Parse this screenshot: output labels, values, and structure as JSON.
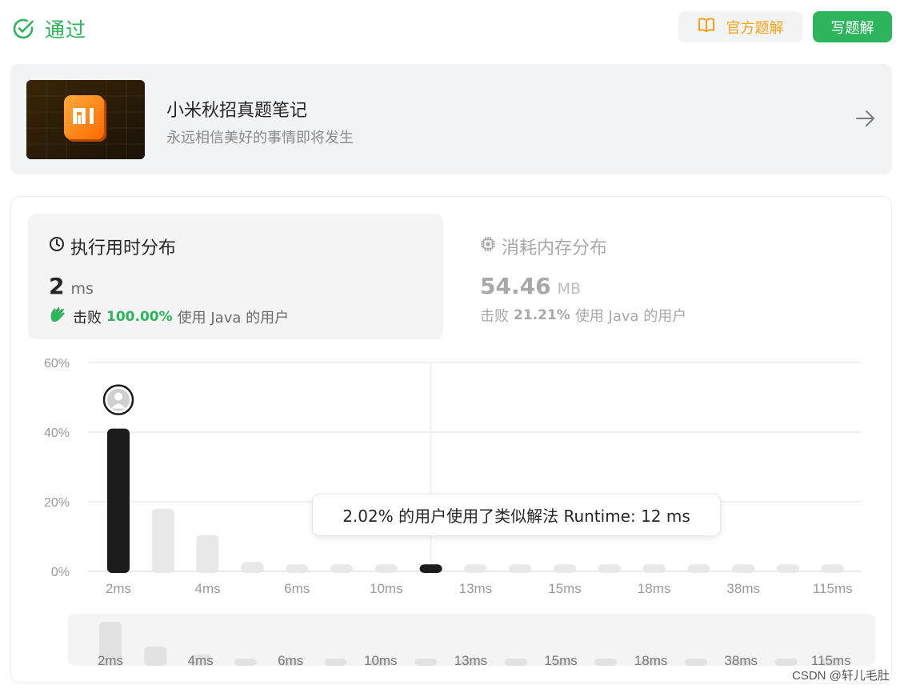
{
  "header": {
    "status": "通过",
    "official_solution_label": "官方题解",
    "write_solution_label": "写题解"
  },
  "promo": {
    "title": "小米秋招真题笔记",
    "subtitle": "永远相信美好的事情即将发生",
    "logo_text": "mi"
  },
  "runtime": {
    "tab_label": "执行用时分布",
    "value": "2",
    "unit": "ms",
    "beat_label": "击败",
    "beat_pct": "100.00%",
    "beat_suffix": "使用 Java 的用户"
  },
  "memory": {
    "tab_label": "消耗内存分布",
    "value": "54.46",
    "unit": "MB",
    "beat_label": "击败",
    "beat_pct": "21.21%",
    "beat_suffix": "使用 Java 的用户"
  },
  "tooltip": "2.02% 的用户使用了类似解法 Runtime: 12 ms",
  "watermark": "CSDN @轩儿毛肚",
  "colors": {
    "accent_green": "#2db55d",
    "accent_orange": "#ffa116",
    "bar_highlight": "#1c1c1c",
    "bar_default": "#e8e8e8"
  },
  "icons": {
    "status": "check-circle-icon",
    "official": "book-open-icon",
    "promo_arrow": "arrow-right-icon",
    "runtime": "clock-icon",
    "memory": "chip-icon",
    "beat": "clap-hands-icon",
    "user_marker": "user-avatar-icon"
  },
  "chart_data": {
    "type": "bar",
    "ylim": [
      0,
      60
    ],
    "yticks": [
      "0%",
      "20%",
      "40%",
      "60%"
    ],
    "grid": true,
    "x_tick_labels": [
      "2ms",
      "4ms",
      "6ms",
      "10ms",
      "13ms",
      "15ms",
      "18ms",
      "38ms",
      "115ms"
    ],
    "values": [
      41,
      18,
      10.5,
      2.7,
      2,
      2,
      2,
      2.02,
      2,
      2,
      2,
      2,
      2,
      2,
      2,
      2,
      2
    ],
    "highlighted_indices": [
      0,
      7
    ],
    "current_user_index": 0
  }
}
